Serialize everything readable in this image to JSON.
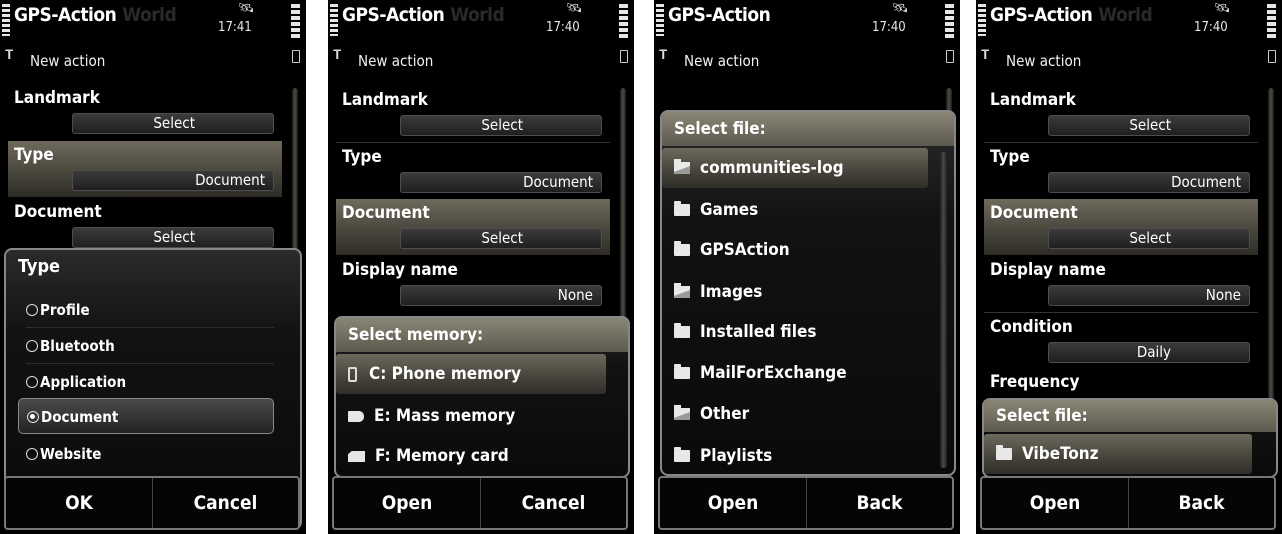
{
  "screens": [
    {
      "app_title": "GPS-Action",
      "ghost_text": "World",
      "time": "17:41",
      "subtitle": "New action",
      "fields": [
        {
          "label": "Landmark",
          "value": "Select"
        },
        {
          "label": "Type",
          "value": "Document"
        },
        {
          "label": "Document",
          "value": "Select"
        }
      ],
      "dialog": {
        "title": "Type",
        "options": [
          "Profile",
          "Bluetooth",
          "Application",
          "Document",
          "Website"
        ],
        "selected": "Document"
      },
      "softkeys": {
        "left": "OK",
        "right": "Cancel"
      }
    },
    {
      "app_title": "GPS-Action",
      "ghost_text": "World",
      "time": "17:40",
      "subtitle": "New action",
      "fields": [
        {
          "label": "Landmark",
          "value": "Select"
        },
        {
          "label": "Type",
          "value": "Document"
        },
        {
          "label": "Document",
          "value": "Select"
        },
        {
          "label": "Display name",
          "value": "None"
        }
      ],
      "dialog": {
        "title": "Select memory:",
        "items": [
          {
            "label": "C: Phone memory",
            "icon": "phone-memory-icon"
          },
          {
            "label": "E: Mass memory",
            "icon": "mass-memory-icon"
          },
          {
            "label": "F: Memory card",
            "icon": "memory-card-icon"
          }
        ]
      },
      "softkeys": {
        "left": "Open",
        "right": "Cancel"
      }
    },
    {
      "app_title": "GPS-Action",
      "time": "17:40",
      "subtitle": "New action",
      "dialog": {
        "title": "Select file:",
        "items": [
          {
            "label": "communities-log",
            "icon": "folder-open-icon"
          },
          {
            "label": "Games",
            "icon": "folder-icon"
          },
          {
            "label": "GPSAction",
            "icon": "folder-icon"
          },
          {
            "label": "Images",
            "icon": "folder-open-icon"
          },
          {
            "label": "Installed files",
            "icon": "folder-icon"
          },
          {
            "label": "MailForExchange",
            "icon": "folder-icon"
          },
          {
            "label": "Other",
            "icon": "folder-open-icon"
          },
          {
            "label": "Playlists",
            "icon": "folder-icon"
          }
        ]
      },
      "softkeys": {
        "left": "Open",
        "right": "Back"
      }
    },
    {
      "app_title": "GPS-Action",
      "ghost_text": "World",
      "time": "17:40",
      "subtitle": "New action",
      "fields": [
        {
          "label": "Landmark",
          "value": "Select"
        },
        {
          "label": "Type",
          "value": "Document"
        },
        {
          "label": "Document",
          "value": "Select"
        },
        {
          "label": "Display name",
          "value": "None"
        },
        {
          "label": "Condition",
          "value": "Daily"
        },
        {
          "label": "Frequency",
          "value": ""
        }
      ],
      "dialog": {
        "title": "Select file:",
        "items": [
          {
            "label": "VibeTonz",
            "icon": "folder-icon"
          }
        ]
      },
      "softkeys": {
        "left": "Open",
        "right": "Back"
      }
    }
  ]
}
